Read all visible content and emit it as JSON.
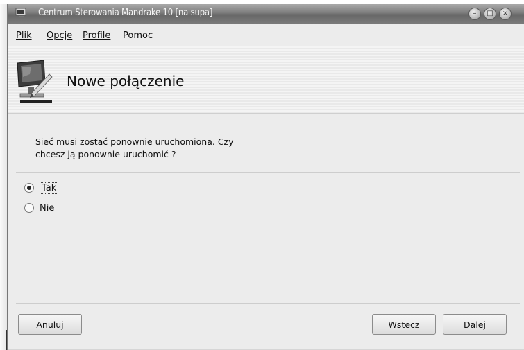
{
  "window": {
    "title": "Centrum Sterowania Mandrake 10 [na supa]"
  },
  "menubar": {
    "items": [
      {
        "label": "Plik"
      },
      {
        "label": "Opcje"
      },
      {
        "label": "Profile"
      },
      {
        "label": "Pomoc"
      }
    ]
  },
  "header": {
    "title": "Nowe połączenie",
    "icon": "network-computer-icon"
  },
  "content": {
    "question": "Sieć musi zostać ponownie uruchomiona. Czy chcesz ją ponownie uruchomić ?",
    "options": [
      {
        "label": "Tak",
        "selected": true
      },
      {
        "label": "Nie",
        "selected": false
      }
    ]
  },
  "buttons": {
    "cancel": "Anuluj",
    "back": "Wstecz",
    "next": "Dalej"
  }
}
